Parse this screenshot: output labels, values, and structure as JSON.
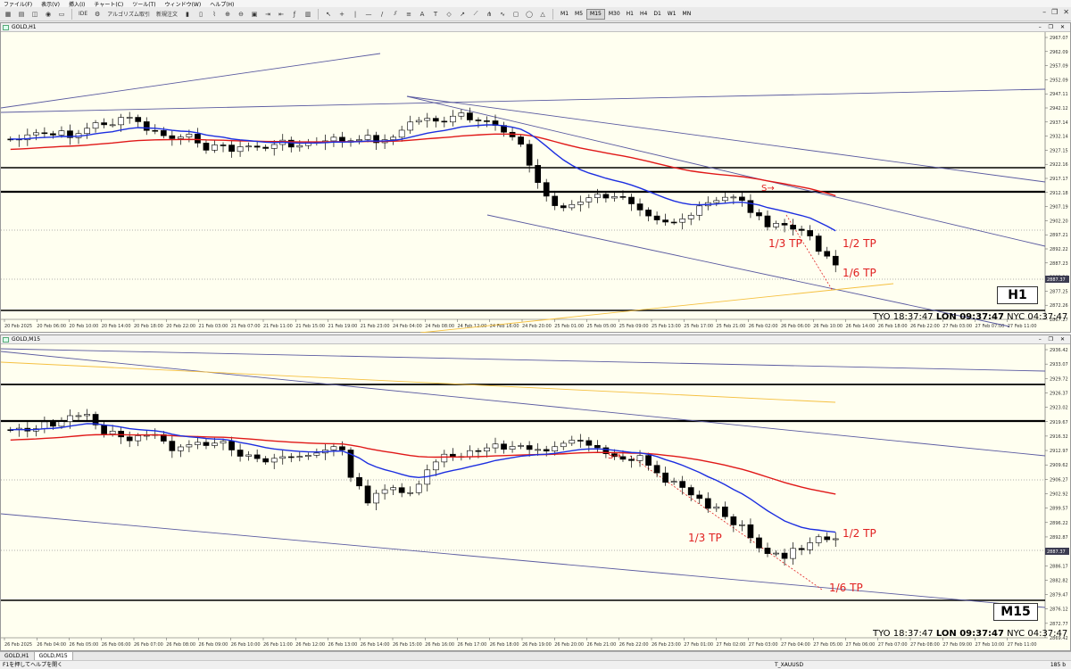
{
  "menu": [
    "ファイル(F)",
    "表示(V)",
    "挿入(I)",
    "チャート(C)",
    "ツール(T)",
    "ウィンドウ(W)",
    "ヘルプ(H)"
  ],
  "toolbar": {
    "algo_label": "アルゴリズム取引",
    "new_order_label": "新規注文",
    "ide_label": "IDE"
  },
  "timeframes": [
    "M1",
    "M5",
    "M15",
    "M30",
    "H1",
    "H4",
    "D1",
    "W1",
    "MN"
  ],
  "active_timeframe": "M15",
  "h1": {
    "title": "GOLD,H1",
    "badge": "H1",
    "clock": {
      "tyo": "TYO 18:37:47",
      "lon": "LON 09:37:47",
      "nyc": "NYC 04:37:47"
    },
    "tp_labels": {
      "third": "1/3 TP",
      "half": "1/2 TP",
      "sixth": "1/6 TP"
    },
    "signal": "S→",
    "current_price": "2887.37",
    "price_ticks": [
      "2967.07",
      "2962.09",
      "2957.09",
      "2952.09",
      "2947.11",
      "2942.12",
      "2937.14",
      "2932.14",
      "2927.15",
      "2922.16",
      "2917.17",
      "2912.18",
      "2907.19",
      "2902.20",
      "2897.21",
      "2892.22",
      "2887.23",
      "2882.24",
      "2877.25",
      "2872.26",
      "2867.27"
    ],
    "time_ticks": [
      "20 Feb 2025",
      "20 Feb 06:00",
      "20 Feb 10:00",
      "20 Feb 14:00",
      "20 Feb 18:00",
      "20 Feb 22:00",
      "21 Feb 03:00",
      "21 Feb 07:00",
      "21 Feb 11:00",
      "21 Feb 15:00",
      "21 Feb 19:00",
      "21 Feb 23:00",
      "24 Feb 04:00",
      "24 Feb 08:00",
      "24 Feb 12:00",
      "24 Feb 16:00",
      "24 Feb 20:00",
      "25 Feb 01:00",
      "25 Feb 05:00",
      "25 Feb 09:00",
      "25 Feb 13:00",
      "25 Feb 17:00",
      "25 Feb 21:00",
      "26 Feb 02:00",
      "26 Feb 06:00",
      "26 Feb 10:00",
      "26 Feb 14:00",
      "26 Feb 18:00",
      "26 Feb 22:00",
      "27 Feb 03:00",
      "27 Feb 07:00",
      "27 Feb 11:00"
    ]
  },
  "m15": {
    "title": "GOLD,M15",
    "badge": "M15",
    "clock": {
      "tyo": "TYO 18:37:47",
      "lon": "LON 09:37:47",
      "nyc": "NYC 04:37:47"
    },
    "tp_labels": {
      "third": "1/3 TP",
      "half": "1/2 TP",
      "sixth": "1/6 TP"
    },
    "signal": "S→",
    "current_price": "2887.37",
    "price_ticks": [
      "2936.42",
      "2933.07",
      "2929.72",
      "2926.37",
      "2923.02",
      "2919.67",
      "2916.32",
      "2912.97",
      "2909.62",
      "2906.27",
      "2902.92",
      "2899.57",
      "2896.22",
      "2892.87",
      "2889.52",
      "2886.17",
      "2882.82",
      "2879.47",
      "2876.12",
      "2872.77",
      "2869.42"
    ],
    "time_ticks": [
      "26 Feb 2025",
      "26 Feb 04:00",
      "26 Feb 05:00",
      "26 Feb 06:00",
      "26 Feb 07:00",
      "26 Feb 08:00",
      "26 Feb 09:00",
      "26 Feb 10:00",
      "26 Feb 11:00",
      "26 Feb 12:00",
      "26 Feb 13:00",
      "26 Feb 14:00",
      "26 Feb 15:00",
      "26 Feb 16:00",
      "26 Feb 17:00",
      "26 Feb 18:00",
      "26 Feb 19:00",
      "26 Feb 20:00",
      "26 Feb 21:00",
      "26 Feb 22:00",
      "26 Feb 23:00",
      "27 Feb 01:00",
      "27 Feb 02:00",
      "27 Feb 03:00",
      "27 Feb 04:00",
      "27 Feb 05:00",
      "27 Feb 06:00",
      "27 Feb 07:00",
      "27 Feb 08:00",
      "27 Feb 09:00",
      "27 Feb 10:00",
      "27 Feb 11:00"
    ]
  },
  "tabs": [
    "GOLD,H1",
    "GOLD,M15"
  ],
  "status": {
    "help": "F1を押してヘルプを開く",
    "symbol": "T_XAUUSD",
    "traffic": "185 b"
  },
  "colors": {
    "bg": "#fffff0",
    "ema_fast": "#1c2ee0",
    "ema_slow": "#e01818",
    "trend": "#5a5aa0",
    "tp": "#e02020",
    "fibo": "#f5c040"
  }
}
